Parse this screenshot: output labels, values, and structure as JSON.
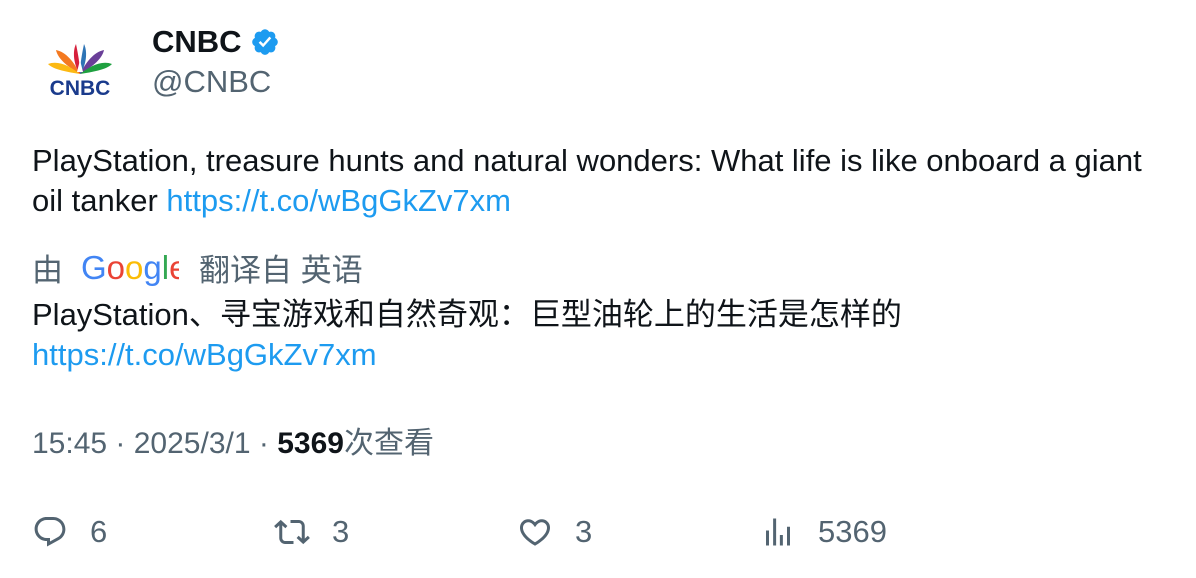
{
  "author": {
    "avatar_wordmark": "CNBC",
    "display_name": "CNBC",
    "handle": "@CNBC",
    "verified_icon": "verified-badge-icon"
  },
  "tweet": {
    "text": "PlayStation, treasure hunts and natural wonders: What life is like onboard a giant oil tanker ",
    "link": "https://t.co/wBgGkZv7xm"
  },
  "translation": {
    "prefix": "由",
    "provider": "Google",
    "suffix": "翻译自 英语",
    "text": "PlayStation、寻宝游戏和自然奇观：巨型油轮上的生活是怎样的",
    "link": "https://t.co/wBgGkZv7xm"
  },
  "meta": {
    "time": "15:45",
    "separator": " · ",
    "date": "2025/3/1",
    "views_count": "5369",
    "views_label": "次查看"
  },
  "actions": {
    "reply": {
      "icon": "reply-icon",
      "count": "6"
    },
    "retweet": {
      "icon": "retweet-icon",
      "count": "3"
    },
    "like": {
      "icon": "heart-icon",
      "count": "3"
    },
    "views": {
      "icon": "bar-chart-icon",
      "count": "5369"
    }
  },
  "colors": {
    "link": "#1d9bf0",
    "secondary_text": "#536471",
    "primary_text": "#0f1419",
    "verified": "#1d9bf0"
  }
}
